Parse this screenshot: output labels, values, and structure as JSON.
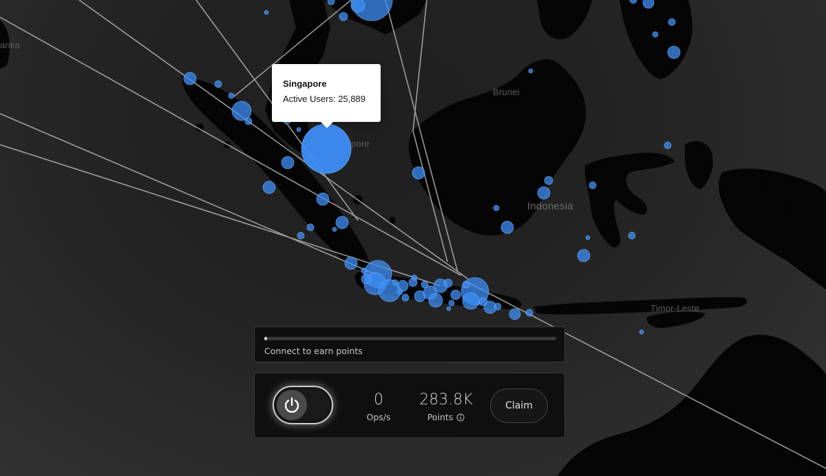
{
  "map": {
    "labels": {
      "sri_lanka_partial": "anka",
      "brunei": "Brunei",
      "singapore_partial": "pore",
      "indonesia": "Indonesia",
      "timor_leste": "Timor-Leste"
    },
    "colors": {
      "background": "#262626",
      "land": "#050505",
      "marker": "#3d8ef5",
      "arc": "#bdbdbd"
    }
  },
  "tooltip": {
    "title": "Singapore",
    "metric_label": "Active Users:",
    "metric_value": "25,889"
  },
  "progress": {
    "value": 0.005,
    "status_text": "Connect to earn points"
  },
  "controls": {
    "power_state": "off",
    "power_icon": "power-icon",
    "ops": {
      "value": "0",
      "label": "Ops/s"
    },
    "points": {
      "value": "283.8K",
      "label": "Points",
      "info_icon": "info-icon"
    },
    "claim_label": "Claim"
  }
}
